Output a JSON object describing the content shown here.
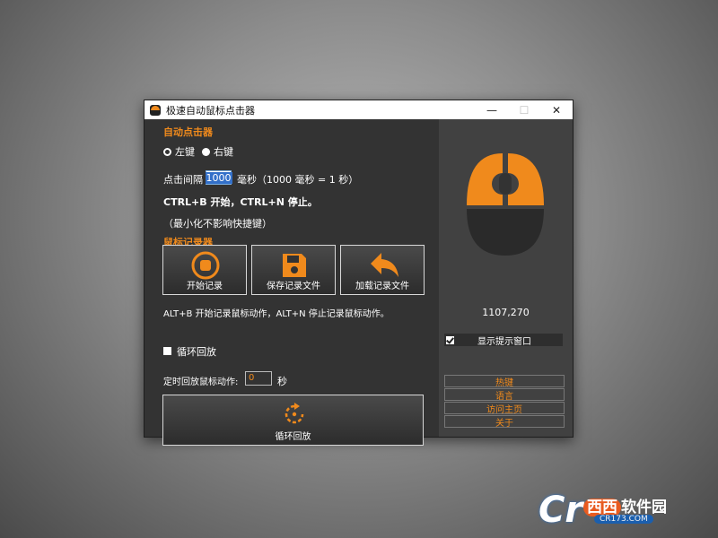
{
  "window": {
    "title": "极速自动鼠标点击器",
    "minimize": "—",
    "maximize": "☐",
    "close": "✕"
  },
  "auto_click": {
    "section_title": "自动点击器",
    "left_key": "左键",
    "right_key": "右键",
    "interval_label": "点击间隔",
    "interval_value": "1000",
    "interval_unit": "毫秒（1000 毫秒 = 1 秒）",
    "hotkey_text": "CTRL+B 开始，CTRL+N 停止。",
    "minimize_note": "（最小化不影响快捷键）"
  },
  "recorder": {
    "section_title": "鼠标记录器",
    "start_label": "开始记录",
    "save_label": "保存记录文件",
    "load_label": "加载记录文件",
    "hotkey_text": "ALT+B 开始记录鼠标动作，ALT+N 停止记录鼠标动作。",
    "loop_label": "循环回放",
    "timed_label": "定时回放鼠标动作:",
    "timed_value": "0",
    "timed_unit": "秒",
    "loop_button_label": "循环回放"
  },
  "side": {
    "coordinates": "1107,270",
    "show_tip_label": "显示提示窗口",
    "links": [
      "热键",
      "语言",
      "访问主页",
      "关于"
    ]
  },
  "colors": {
    "accent": "#f08a1c",
    "panel": "#333333",
    "side_panel": "#414141"
  },
  "watermark": {
    "logo": "Cr",
    "name_hl": "西西",
    "name": "软件园",
    "url": "CR173.COM"
  }
}
